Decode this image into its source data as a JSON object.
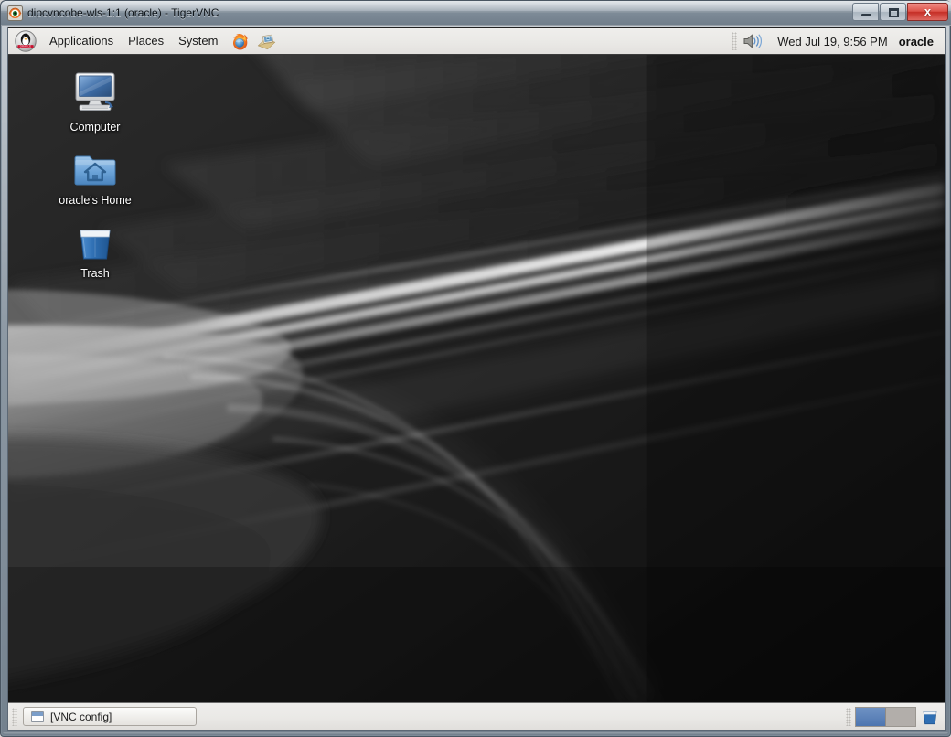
{
  "window": {
    "title": "dipcvncobe-wls-1:1 (oracle) - TigerVNC",
    "icon": "tigervnc-icon",
    "controls": {
      "minimize": "minimize-button",
      "maximize": "maximize-button",
      "close_glyph": "x"
    }
  },
  "top_panel": {
    "logo": "oracle-linux-penguin-logo",
    "menus": [
      {
        "label": "Applications"
      },
      {
        "label": "Places"
      },
      {
        "label": "System"
      }
    ],
    "launchers": [
      {
        "name": "firefox-icon",
        "tooltip": "Firefox Web Browser"
      },
      {
        "name": "evolution-mail-icon",
        "tooltip": "Evolution Mail"
      }
    ],
    "tray": {
      "volume_icon": "volume-speaker-icon",
      "clock": "Wed Jul 19,  9:56 PM",
      "user": "oracle"
    }
  },
  "desktop": {
    "icons": [
      {
        "name": "computer",
        "label": "Computer"
      },
      {
        "name": "home-folder",
        "label": "oracle's Home"
      },
      {
        "name": "trash",
        "label": "Trash"
      }
    ],
    "wallpaper": {
      "description": "dark grayscale motion-blur light streaks",
      "base_color": "#232323"
    }
  },
  "bottom_panel": {
    "tasks": [
      {
        "label": "[VNC config]",
        "icon": "window-icon"
      }
    ],
    "workspaces": [
      {
        "name": "workspace-1",
        "active": true
      },
      {
        "name": "workspace-2",
        "active": false
      }
    ],
    "trash_applet": "trash-applet-icon"
  },
  "colors": {
    "panel_bg": "#eae9e6",
    "accent_blue": "#4e76b0",
    "close_red": "#c52e26",
    "desktop_bg": "#232323"
  }
}
